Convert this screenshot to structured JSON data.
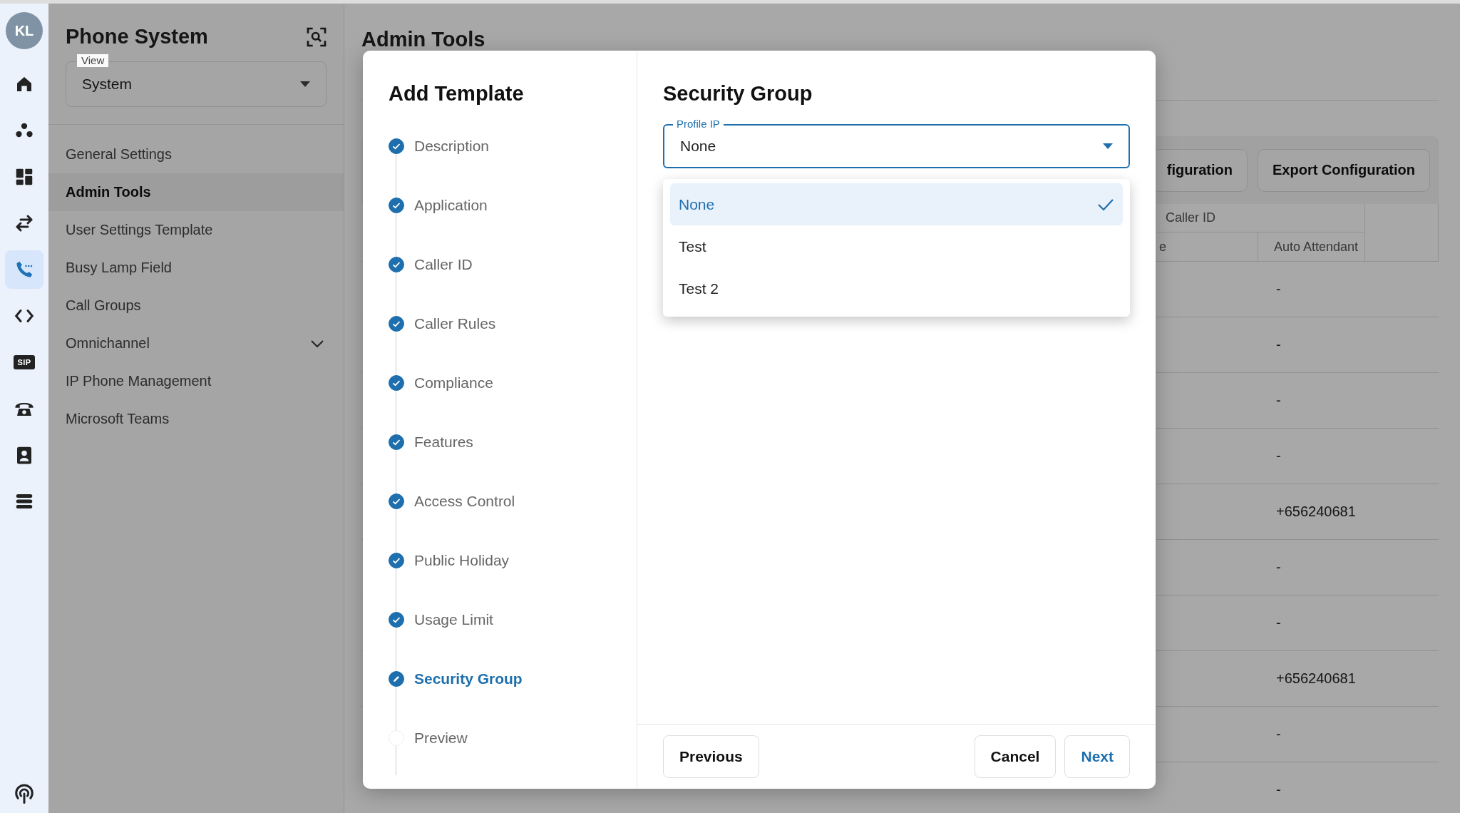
{
  "rail": {
    "avatar": "KL",
    "items": [
      {
        "kind": "icon",
        "selected": false
      },
      {
        "kind": "icon",
        "selected": false
      },
      {
        "kind": "icon",
        "selected": false
      },
      {
        "kind": "icon",
        "selected": false
      },
      {
        "kind": "icon",
        "selected": true
      },
      {
        "kind": "icon",
        "selected": false
      },
      {
        "kind": "badge",
        "label": "SIP",
        "selected": false
      },
      {
        "kind": "icon",
        "selected": false
      },
      {
        "kind": "icon",
        "selected": false
      },
      {
        "kind": "icon",
        "selected": false
      }
    ]
  },
  "sidebar": {
    "title": "Phone System",
    "view": {
      "label": "View",
      "value": "System"
    },
    "items": [
      {
        "kind": "link",
        "label": "General Settings",
        "selected": false
      },
      {
        "kind": "link",
        "label": "Admin Tools",
        "selected": true
      },
      {
        "kind": "link",
        "label": "User Settings Template",
        "selected": false
      },
      {
        "kind": "link",
        "label": "Busy Lamp Field",
        "selected": false
      },
      {
        "kind": "link",
        "label": "Call Groups",
        "selected": false
      },
      {
        "kind": "group",
        "label": "Omnichannel",
        "selected": false,
        "expanded": false
      },
      {
        "kind": "link",
        "label": "IP Phone Management",
        "selected": false
      },
      {
        "kind": "link",
        "label": "Microsoft Teams",
        "selected": false
      }
    ]
  },
  "page": {
    "title": "Admin Tools",
    "toolbar_buttons": [
      "figuration",
      "Export Configuration"
    ],
    "table": {
      "group_header": "Caller ID",
      "columns": [
        "e",
        "Auto Attendant"
      ],
      "rows": [
        {
          "auto_attendant": "-"
        },
        {
          "auto_attendant": "-"
        },
        {
          "auto_attendant": "-"
        },
        {
          "auto_attendant": "-"
        },
        {
          "auto_attendant": "+656240681"
        },
        {
          "auto_attendant": "-"
        },
        {
          "auto_attendant": "-"
        },
        {
          "auto_attendant": "+656240681"
        },
        {
          "auto_attendant": "-"
        },
        {
          "auto_attendant": "-"
        }
      ]
    }
  },
  "modal": {
    "title": "Add Template",
    "steps": [
      {
        "label": "Description",
        "done": true,
        "selected": false
      },
      {
        "label": "Application",
        "done": true,
        "selected": false
      },
      {
        "label": "Caller ID",
        "done": true,
        "selected": false
      },
      {
        "label": "Caller Rules",
        "done": true,
        "selected": false
      },
      {
        "label": "Compliance",
        "done": true,
        "selected": false
      },
      {
        "label": "Features",
        "done": true,
        "selected": false
      },
      {
        "label": "Access Control",
        "done": true,
        "selected": false
      },
      {
        "label": "Public Holiday",
        "done": true,
        "selected": false
      },
      {
        "label": "Usage Limit",
        "done": true,
        "selected": false
      },
      {
        "label": "Security Group",
        "done": false,
        "selected": true
      },
      {
        "label": "Preview",
        "done": false,
        "selected": false
      }
    ],
    "section_title": "Security Group",
    "select": {
      "label": "Profile IP",
      "value": "None",
      "open": true
    },
    "options": [
      {
        "label": "None",
        "selected": true
      },
      {
        "label": "Test",
        "selected": false
      },
      {
        "label": "Test 2",
        "selected": false
      }
    ],
    "buttons": {
      "previous": "Previous",
      "cancel": "Cancel",
      "next": "Next"
    }
  }
}
